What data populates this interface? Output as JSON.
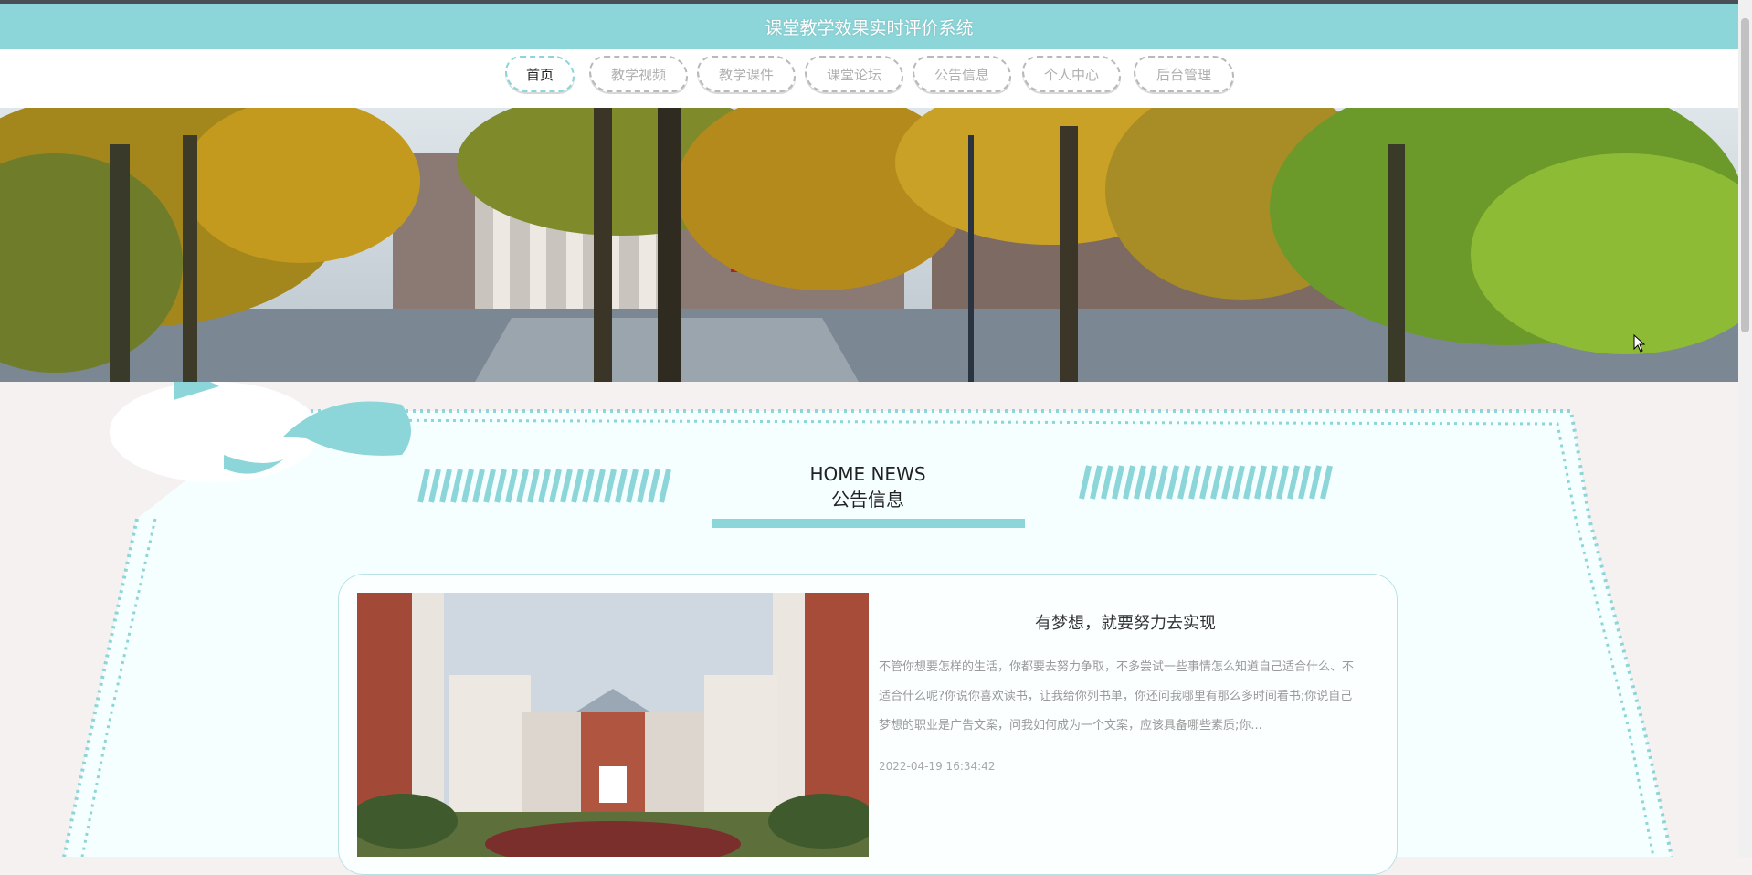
{
  "header": {
    "title": "课堂教学效果实时评价系统"
  },
  "nav": {
    "items": [
      {
        "label": "首页",
        "active": true
      },
      {
        "label": "教学视频",
        "active": false
      },
      {
        "label": "教学课件",
        "active": false
      },
      {
        "label": "课堂论坛",
        "active": false
      },
      {
        "label": "公告信息",
        "active": false
      },
      {
        "label": "个人中心",
        "active": false
      },
      {
        "label": "后台管理",
        "active": false
      }
    ]
  },
  "section": {
    "title_en": "HOME NEWS",
    "title_cn": "公告信息"
  },
  "news": [
    {
      "headline": "有梦想，就要努力去实现",
      "excerpt": "不管你想要怎样的生活，你都要去努力争取，不多尝试一些事情怎么知道自己适合什么、不适合什么呢?你说你喜欢读书，让我给你列书单，你还问我哪里有那么多时间看书;你说自己梦想的职业是广告文案，问我如何成为一个文案，应该具备哪些素质;你...",
      "date": "2022-04-19 16:34:42"
    }
  ],
  "colors": {
    "accent": "#8cd5d8",
    "title_text": "#ffffff",
    "page_bg": "#f5f1f1"
  },
  "icons": [
    "mouse-cursor-icon"
  ]
}
